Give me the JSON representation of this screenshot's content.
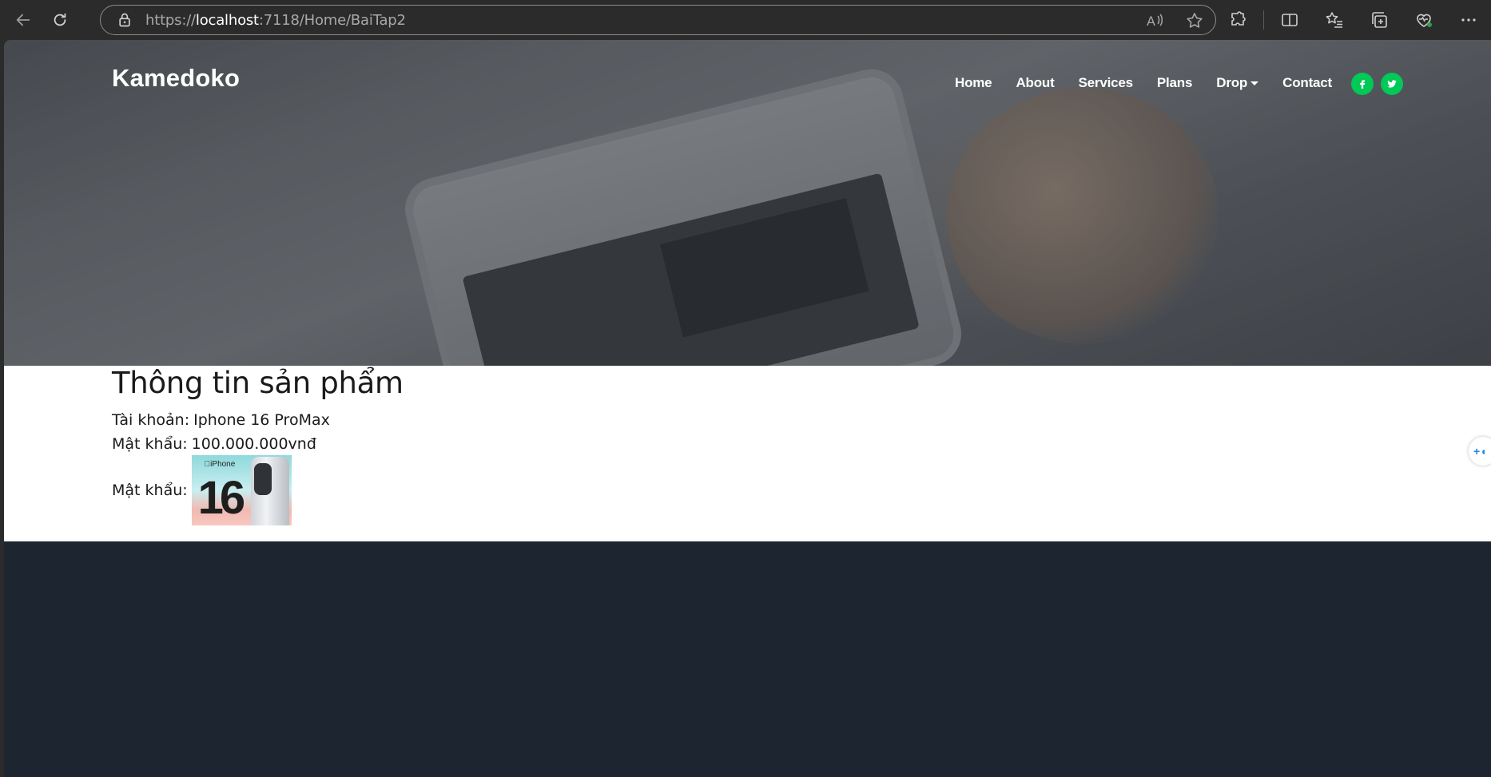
{
  "browser": {
    "url_prefix": "https://",
    "url_host": "localhost",
    "url_rest": ":7118/Home/BaiTap2"
  },
  "site": {
    "brand": "Kamedoko",
    "nav": [
      {
        "label": "Home"
      },
      {
        "label": "About"
      },
      {
        "label": "Services"
      },
      {
        "label": "Plans"
      },
      {
        "label": "Drop"
      },
      {
        "label": "Contact"
      }
    ],
    "social_color": "#00c957"
  },
  "product": {
    "heading": "Thông tin sản phẩm",
    "rows": [
      {
        "label": "Tài khoản:",
        "value": "Iphone 16 ProMax"
      },
      {
        "label": "Mật khẩu:",
        "value": "100.000.000vnđ"
      },
      {
        "label": "Mật khẩu:"
      }
    ],
    "image": {
      "logo_text": "iPhone",
      "number": "16"
    }
  }
}
